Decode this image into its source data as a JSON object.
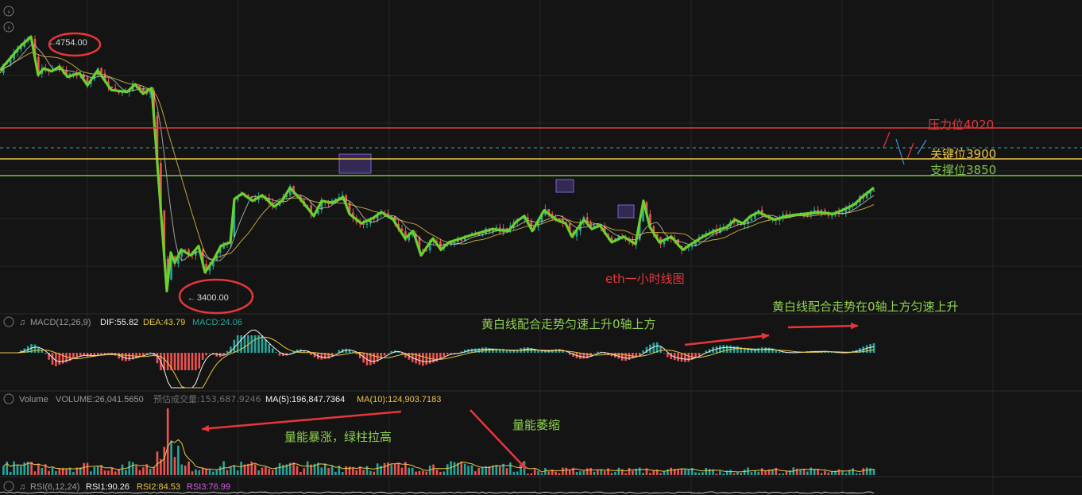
{
  "chart_data": [
    {
      "type": "line",
      "panel": "price",
      "title": "eth一小时线图",
      "high_label": "4754.00",
      "low_label": "3400.00",
      "levels": [
        {
          "name": "压力位4020",
          "value": 4020,
          "color": "#e8363a"
        },
        {
          "name": "关键位3900",
          "value": 3900,
          "color": "#e8c547"
        },
        {
          "name": "支撑位3850",
          "value": 3850,
          "color": "#7cc24a"
        }
      ],
      "current_price_dashed": 3930,
      "price_range": [
        3300,
        4780
      ],
      "bar_count": 250,
      "series": [
        {
          "color": "#6ad12e",
          "points": [
            [
              0,
              4575
            ],
            [
              13,
              4640
            ],
            [
              25,
              4700
            ],
            [
              39,
              4754
            ],
            [
              48,
              4550
            ],
            [
              55,
              4585
            ],
            [
              65,
              4570
            ],
            [
              75,
              4595
            ],
            [
              85,
              4540
            ],
            [
              100,
              4560
            ],
            [
              110,
              4495
            ],
            [
              123,
              4575
            ],
            [
              140,
              4470
            ],
            [
              160,
              4460
            ],
            [
              170,
              4500
            ],
            [
              180,
              4450
            ],
            [
              191,
              4480
            ],
            [
              210,
              3400
            ],
            [
              215,
              3605
            ],
            [
              220,
              3550
            ],
            [
              228,
              3620
            ],
            [
              240,
              3590
            ],
            [
              250,
              3640
            ],
            [
              258,
              3500
            ],
            [
              268,
              3560
            ],
            [
              278,
              3640
            ],
            [
              290,
              3660
            ],
            [
              295,
              3890
            ],
            [
              305,
              3920
            ],
            [
              318,
              3880
            ],
            [
              330,
              3910
            ],
            [
              345,
              3850
            ],
            [
              355,
              3880
            ],
            [
              365,
              3950
            ],
            [
              380,
              3880
            ],
            [
              395,
              3800
            ],
            [
              405,
              3880
            ],
            [
              418,
              3870
            ],
            [
              432,
              3900
            ],
            [
              440,
              3810
            ],
            [
              455,
              3760
            ],
            [
              470,
              3790
            ],
            [
              480,
              3820
            ],
            [
              495,
              3780
            ],
            [
              510,
              3680
            ],
            [
              520,
              3720
            ],
            [
              530,
              3590
            ],
            [
              545,
              3680
            ],
            [
              555,
              3620
            ],
            [
              565,
              3660
            ],
            [
              580,
              3680
            ],
            [
              595,
              3700
            ],
            [
              620,
              3730
            ],
            [
              640,
              3720
            ],
            [
              650,
              3770
            ],
            [
              660,
              3800
            ],
            [
              670,
              3720
            ],
            [
              685,
              3830
            ],
            [
              700,
              3780
            ],
            [
              712,
              3760
            ],
            [
              720,
              3690
            ],
            [
              735,
              3780
            ],
            [
              745,
              3730
            ],
            [
              755,
              3750
            ],
            [
              770,
              3660
            ],
            [
              785,
              3690
            ],
            [
              800,
              3650
            ],
            [
              810,
              3880
            ],
            [
              818,
              3740
            ],
            [
              830,
              3660
            ],
            [
              845,
              3690
            ],
            [
              855,
              3640
            ],
            [
              860,
              3620
            ],
            [
              870,
              3650
            ],
            [
              885,
              3690
            ],
            [
              900,
              3720
            ],
            [
              915,
              3740
            ],
            [
              925,
              3780
            ],
            [
              935,
              3760
            ],
            [
              945,
              3800
            ],
            [
              955,
              3820
            ],
            [
              965,
              3800
            ],
            [
              975,
              3780
            ],
            [
              990,
              3800
            ],
            [
              1010,
              3810
            ],
            [
              1030,
              3820
            ],
            [
              1048,
              3810
            ],
            [
              1060,
              3830
            ],
            [
              1075,
              3860
            ],
            [
              1085,
              3900
            ],
            [
              1100,
              3950
            ]
          ]
        }
      ],
      "annotations": [
        {
          "text": "黄白线配合走势匀速上升0轴上方",
          "color": "#8fd14f"
        },
        {
          "text": "黄白线配合走势在0轴上方匀速上升",
          "color": "#8fd14f"
        },
        {
          "text": "量能暴涨，绿柱拉高",
          "color": "#8fd14f"
        },
        {
          "text": "量能萎缩",
          "color": "#8fd14f"
        }
      ]
    },
    {
      "type": "bar",
      "panel": "macd",
      "indicator": "MACD(12,26,9)",
      "dif_label": "DIF:55.82",
      "dea_label": "DEA:43.79",
      "macd_label": "MACD:24.06",
      "dif_color": "#f0f0f0",
      "dea_color": "#e8c547",
      "macd_color": "#26a69a"
    },
    {
      "type": "bar",
      "panel": "volume",
      "indicator": "Volume",
      "volume_label": "VOLUME:26,041.5650",
      "est_label": "预估成交量:153,687.9246",
      "ma5_label": "MA(5):196,847.7364",
      "ma10_label": "MA(10):124,903.7183"
    },
    {
      "type": "line",
      "panel": "rsi",
      "indicator": "RSI(6,12,24)",
      "rsi1_label": "RSI1:90.26",
      "rsi2_label": "RSI2:84.53",
      "rsi3_label": "RSI3:76.99"
    }
  ],
  "colors": {
    "background": "#141414",
    "up": "#26a69a",
    "down": "#ef5350",
    "grid": "#262626",
    "text": "#9a9a9a"
  }
}
